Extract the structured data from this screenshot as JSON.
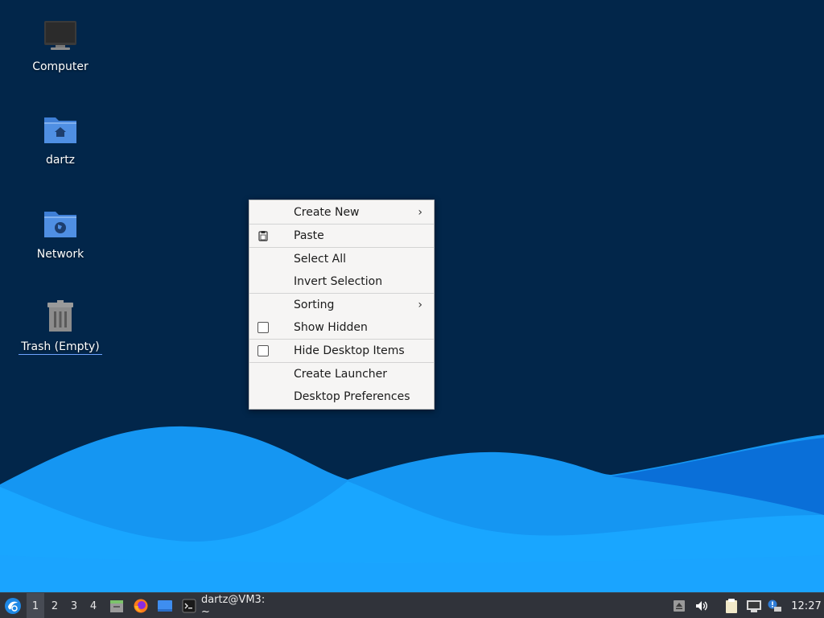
{
  "desktop": {
    "icons": [
      {
        "label": "Computer"
      },
      {
        "label": "dartz"
      },
      {
        "label": "Network"
      },
      {
        "label": "Trash (Empty)"
      }
    ]
  },
  "context_menu": {
    "items": [
      {
        "label": "Create New",
        "submenu": true
      },
      {
        "label": "Paste",
        "icon": "clipboard-icon"
      },
      {
        "label": "Select All"
      },
      {
        "label": "Invert Selection"
      },
      {
        "label": "Sorting",
        "submenu": true
      },
      {
        "label": "Show Hidden",
        "checkbox": true,
        "checked": false
      },
      {
        "label": "Hide Desktop Items",
        "checkbox": true,
        "checked": false
      },
      {
        "label": "Create Launcher"
      },
      {
        "label": "Desktop Preferences"
      }
    ]
  },
  "taskbar": {
    "workspaces": [
      "1",
      "2",
      "3",
      "4"
    ],
    "active_workspace": "1",
    "task": {
      "label": "dartz@VM3: ~"
    },
    "clock": "12:27"
  },
  "colors": {
    "desktop_bg": "#02264a",
    "wave_light": "#1aa0ff",
    "wave_dark": "#0a6fd8",
    "taskbar_bg": "#30333a",
    "menu_bg": "#f6f5f4"
  }
}
